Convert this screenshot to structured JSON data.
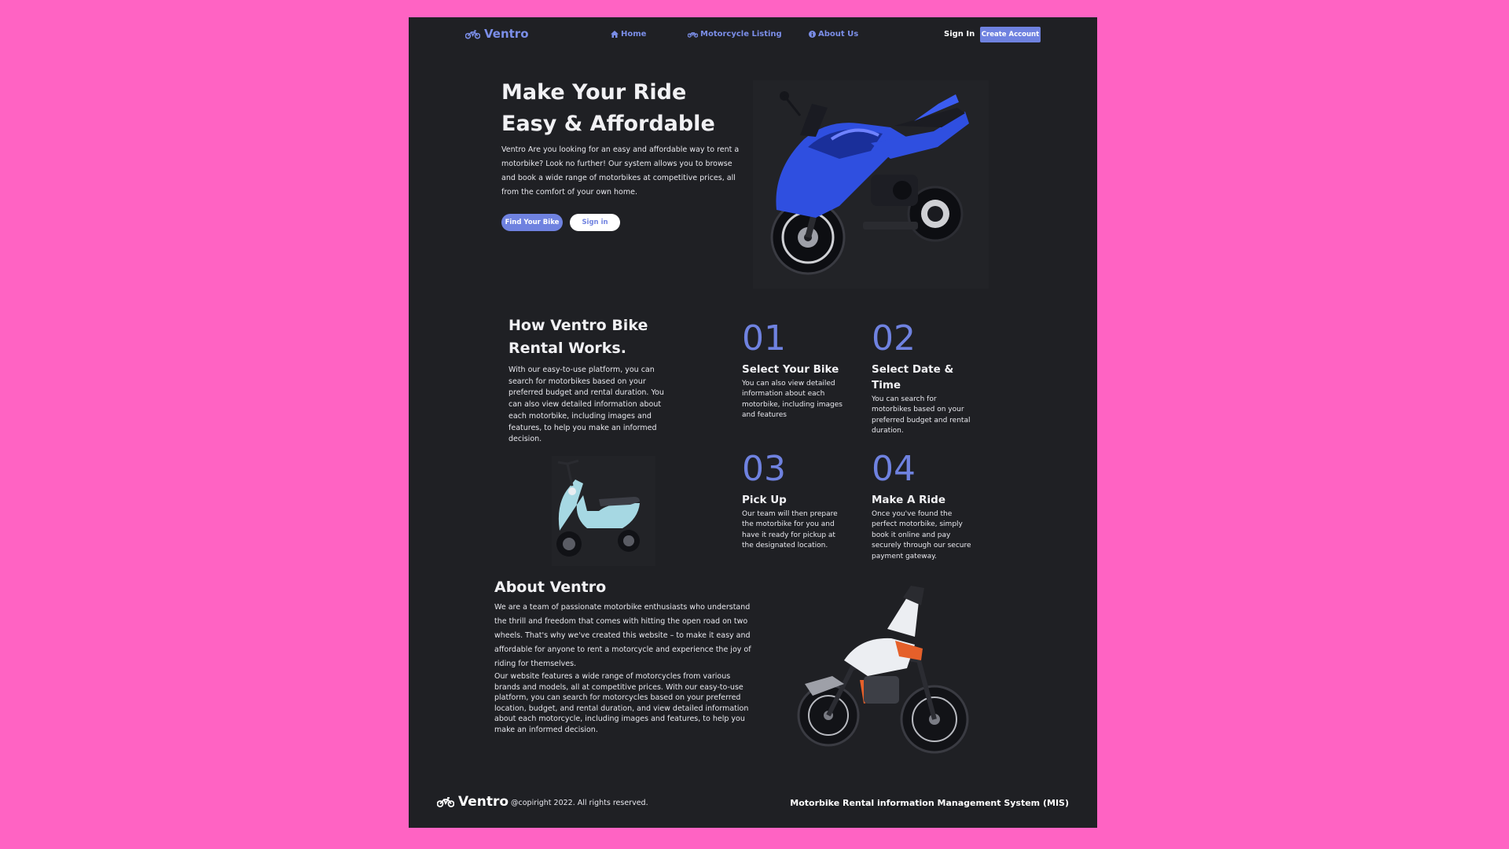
{
  "nav": {
    "brand": "Ventro",
    "links": [
      {
        "label": "Home",
        "icon": "home-icon"
      },
      {
        "label": "Motorcycle Listing",
        "icon": "motorcycle-icon"
      },
      {
        "label": "About Us",
        "icon": "info-icon"
      }
    ],
    "sign_in": "Sign In",
    "create_account": "Create Account"
  },
  "hero": {
    "title_line1": "Make Your Ride",
    "title_line2": "Easy & Affordable",
    "text": "Ventro Are you looking for an easy and affordable way to rent a motorbike? Look no further! Our system allows you to browse and book a wide range of motorbikes at competitive prices, all from the comfort of your own home.",
    "primary_button": "Find Your Bike",
    "secondary_button": "Sign in",
    "image": "blue-sport-motorbike"
  },
  "how": {
    "title_line1": "How Ventro Bike",
    "title_line2": "Rental Works.",
    "text": "With our easy-to-use platform, you can search for motorbikes based on your preferred budget and rental duration. You can also view detailed information about each motorbike, including images and features, to help you make an informed decision.",
    "image": "light-blue-scooter",
    "steps": [
      {
        "number": "01",
        "title": "Select Your Bike",
        "desc": "You can also view detailed information about each motorbike, including images and features"
      },
      {
        "number": "02",
        "title": "Select Date & Time",
        "desc": "You can search for motorbikes based on your preferred budget and rental duration."
      },
      {
        "number": "03",
        "title": "Pick Up",
        "desc": "Our team will then prepare the motorbike for you and have it ready for pickup at the designated location."
      },
      {
        "number": "04",
        "title": "Make A Ride",
        "desc": "Once you've found the perfect motorbike, simply book it online and pay securely through our secure payment gateway."
      }
    ]
  },
  "about": {
    "title": "About Ventro",
    "paragraph1": "We are a team of passionate motorbike enthusiasts who understand the thrill and freedom that comes with hitting the open road on two wheels. That's why we've created this website – to make it easy and affordable for anyone to rent a motorcycle and experience the joy of riding for themselves.",
    "paragraph2": "Our website features a wide range of motorcycles from various brands and models, all at competitive prices. With our easy-to-use platform, you can search for motorcycles based on your preferred location, budget, and rental duration, and view detailed information about each motorcycle, including images and features, to help you make an informed decision.",
    "image": "white-orange-dirt-bike"
  },
  "footer": {
    "brand": "Ventro",
    "copyright": "@copiright 2022. All rights reserved.",
    "system_name": "Motorbike Rental information Management System (MIS)"
  },
  "colors": {
    "page_bg": "#ff63c3",
    "panel_bg": "#1f2024",
    "accent": "#6f82e0"
  }
}
